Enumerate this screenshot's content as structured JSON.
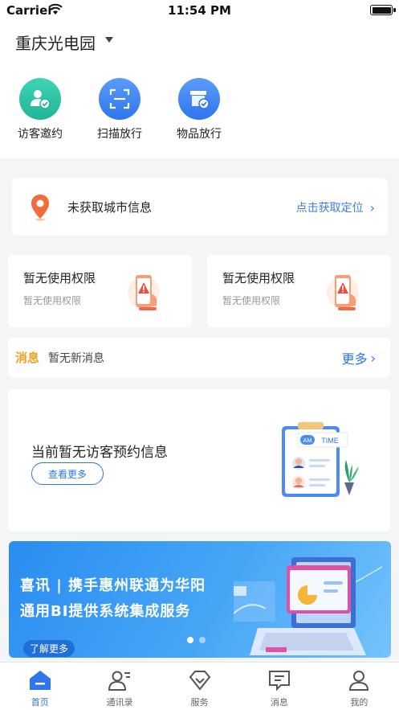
{
  "status_bar": {
    "carrier": "Carrier",
    "time": "11:54 PM"
  },
  "park": {
    "name": "重庆光电园"
  },
  "quick_actions": [
    {
      "label": "访客邀约",
      "icon": "visitor-invite-icon"
    },
    {
      "label": "扫描放行",
      "icon": "scan-icon"
    },
    {
      "label": "物品放行",
      "icon": "goods-release-icon"
    }
  ],
  "location": {
    "text": "未获取城市信息",
    "link": "点击获取定位"
  },
  "permissions": [
    {
      "title": "暂无使用权限",
      "subtitle": "暂无使用权限"
    },
    {
      "title": "暂无使用权限",
      "subtitle": "暂无使用权限"
    }
  ],
  "messages": {
    "tag": "消息",
    "text": "暂无新消息",
    "more": "更多"
  },
  "visitor": {
    "title": "当前暂无访客预约信息",
    "button": "查看更多",
    "badge_am": "AM",
    "badge_time": "TIME"
  },
  "banner": {
    "line1": "喜讯 | 携手惠州联通为华阳",
    "line2": "通用BI提供系统集成服务",
    "button": "了解更多",
    "slide_count": 2,
    "active_slide": 1
  },
  "tabbar": [
    {
      "label": "首页",
      "active": true,
      "icon": "home-icon"
    },
    {
      "label": "通讯录",
      "active": false,
      "icon": "contacts-icon"
    },
    {
      "label": "服务",
      "active": false,
      "icon": "service-icon"
    },
    {
      "label": "消息",
      "active": false,
      "icon": "message-icon"
    },
    {
      "label": "我的",
      "active": false,
      "icon": "profile-icon"
    }
  ],
  "colors": {
    "accent": "#2f75ee",
    "green": "#1fb597",
    "warning": "#f0a020",
    "location_pin": "#f26b3a"
  }
}
